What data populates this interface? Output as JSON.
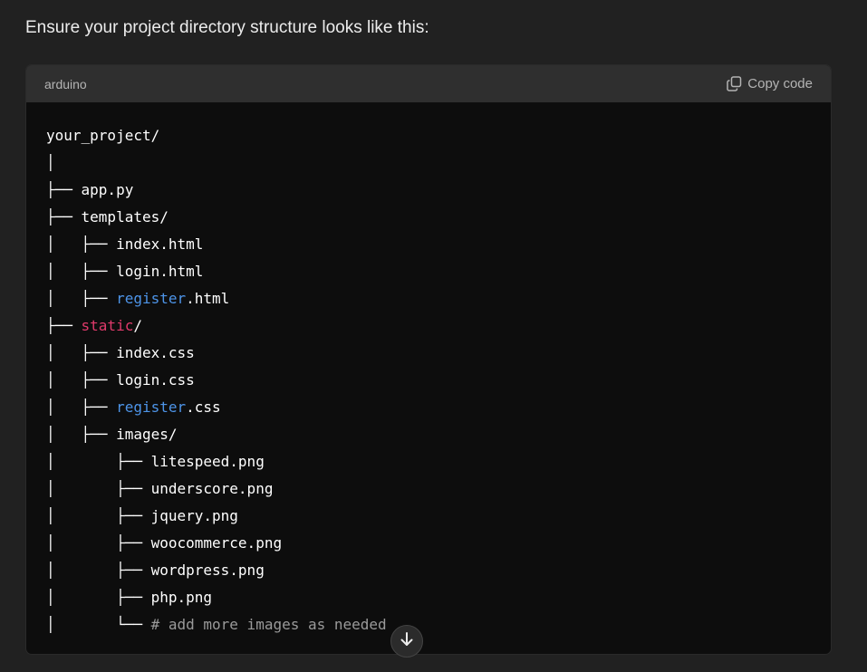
{
  "intro_text": "Ensure your project directory structure looks like this:",
  "code_block": {
    "language": "arduino",
    "copy_label": "Copy code",
    "lines": [
      {
        "prefix": "your_project/",
        "highlight": "",
        "highlight_type": "",
        "suffix": ""
      },
      {
        "prefix": "│",
        "highlight": "",
        "highlight_type": "",
        "suffix": ""
      },
      {
        "prefix": "├── app.py",
        "highlight": "",
        "highlight_type": "",
        "suffix": ""
      },
      {
        "prefix": "├── templates/",
        "highlight": "",
        "highlight_type": "",
        "suffix": ""
      },
      {
        "prefix": "│   ├── index.html",
        "highlight": "",
        "highlight_type": "",
        "suffix": ""
      },
      {
        "prefix": "│   ├── login.html",
        "highlight": "",
        "highlight_type": "",
        "suffix": ""
      },
      {
        "prefix": "│   ├── ",
        "highlight": "register",
        "highlight_type": "blue",
        "suffix": ".html"
      },
      {
        "prefix": "├── ",
        "highlight": "static",
        "highlight_type": "red",
        "suffix": "/"
      },
      {
        "prefix": "│   ├── index.css",
        "highlight": "",
        "highlight_type": "",
        "suffix": ""
      },
      {
        "prefix": "│   ├── login.css",
        "highlight": "",
        "highlight_type": "",
        "suffix": ""
      },
      {
        "prefix": "│   ├── ",
        "highlight": "register",
        "highlight_type": "blue",
        "suffix": ".css"
      },
      {
        "prefix": "│   ├── images/",
        "highlight": "",
        "highlight_type": "",
        "suffix": ""
      },
      {
        "prefix": "│       ├── litespeed.png",
        "highlight": "",
        "highlight_type": "",
        "suffix": ""
      },
      {
        "prefix": "│       ├── underscore.png",
        "highlight": "",
        "highlight_type": "",
        "suffix": ""
      },
      {
        "prefix": "│       ├── jquery.png",
        "highlight": "",
        "highlight_type": "",
        "suffix": ""
      },
      {
        "prefix": "│       ├── woocommerce.png",
        "highlight": "",
        "highlight_type": "",
        "suffix": ""
      },
      {
        "prefix": "│       ├── wordpress.png",
        "highlight": "",
        "highlight_type": "",
        "suffix": ""
      },
      {
        "prefix": "│       ├── php.png",
        "highlight": "",
        "highlight_type": "",
        "suffix": ""
      },
      {
        "prefix": "│       └── ",
        "highlight": "# add more images as needed",
        "highlight_type": "comment",
        "suffix": ""
      }
    ]
  },
  "icons": {
    "copy": "copy-icon",
    "scroll_down": "arrow-down-icon"
  },
  "colors": {
    "page_background": "#212121",
    "code_background": "#0d0d0d",
    "header_background": "#2f2f2f",
    "keyword_blue": "#4d94e8",
    "keyword_red": "#e03a6b",
    "comment_gray": "#9a9a9a"
  }
}
